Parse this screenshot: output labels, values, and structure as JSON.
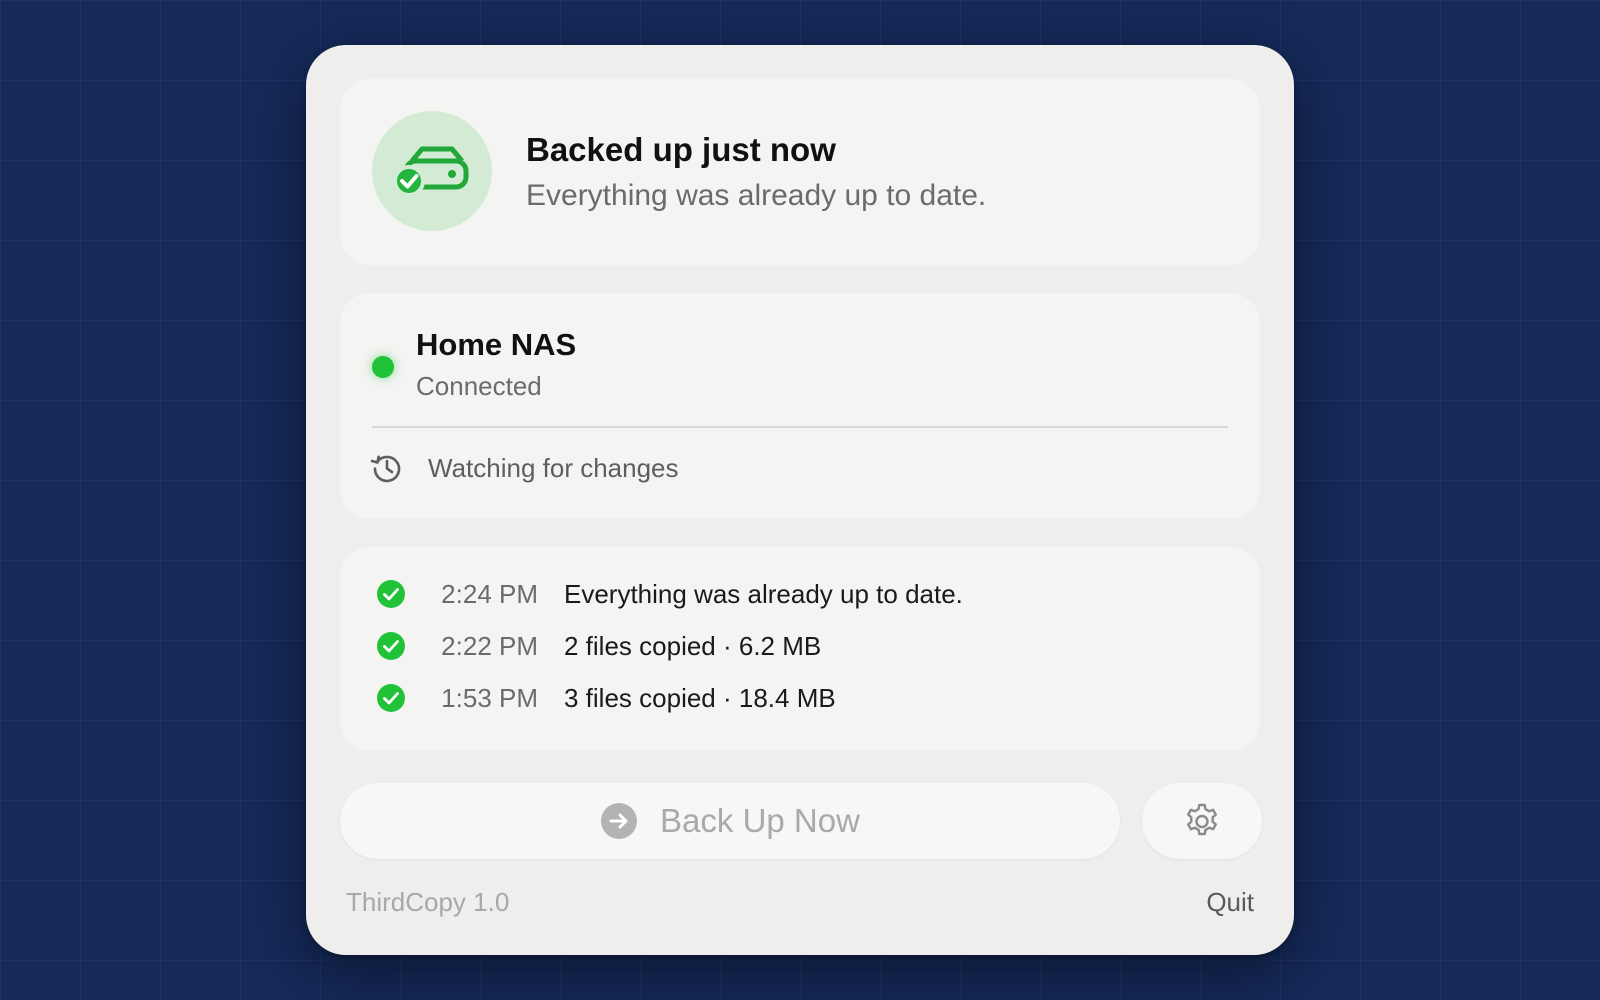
{
  "colors": {
    "accent_green": "#20c237",
    "badge_green_bg": "#d3ebd5",
    "desktop_bg": "#152a5a"
  },
  "status": {
    "icon": "drive-check-icon",
    "title": "Backed up just now",
    "subtitle": "Everything was already up to date."
  },
  "destination": {
    "name": "Home NAS",
    "state": "Connected",
    "indicator": "connected-dot",
    "watch_icon": "history-clock-icon",
    "watch_text": "Watching for changes"
  },
  "history": [
    {
      "icon": "check-circle-icon",
      "time": "2:24 PM",
      "description": "Everything was already up to date."
    },
    {
      "icon": "check-circle-icon",
      "time": "2:22 PM",
      "description": "2 files copied · 6.2 MB"
    },
    {
      "icon": "check-circle-icon",
      "time": "1:53 PM",
      "description": "3 files copied · 18.4 MB"
    }
  ],
  "actions": {
    "backup_label": "Back Up Now",
    "backup_icon": "arrow-right-circle-icon",
    "settings_icon": "gear-icon"
  },
  "footer": {
    "version": "ThirdCopy 1.0",
    "quit_label": "Quit"
  }
}
